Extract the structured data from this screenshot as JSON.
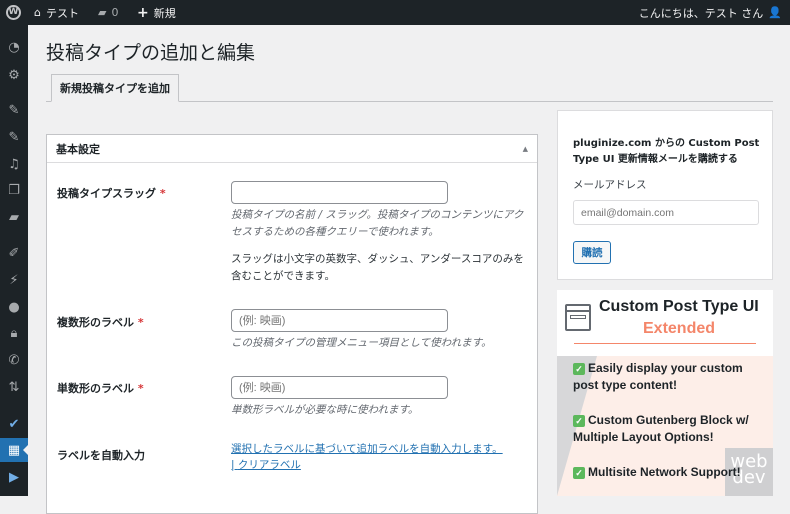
{
  "adminbar": {
    "site": "テスト",
    "comments": "0",
    "new": "新規",
    "greeting": "こんにちは、テスト さん"
  },
  "page": {
    "title": "投稿タイプの追加と編集",
    "tab": "新規投稿タイプを追加"
  },
  "basic": {
    "title": "基本設定",
    "slug": {
      "label": "投稿タイプスラッグ",
      "req": "*",
      "value": "",
      "desc": "投稿タイプの名前 / スラッグ。投稿タイプのコンテンツにアクセスするための各種クエリーで使われます。",
      "note": "スラッグは小文字の英数字、ダッシュ、アンダースコアのみを含むことができます。"
    },
    "plural": {
      "label": "複数形のラベル",
      "req": "*",
      "placeholder": "(例: 映画)",
      "desc": "この投稿タイプの管理メニュー項目として使われます。"
    },
    "singular": {
      "label": "単数形のラベル",
      "req": "*",
      "placeholder": "(例: 映画)",
      "desc": "単数形ラベルが必要な時に使われます。"
    },
    "auto": {
      "label": "ラベルを自動入力",
      "link1": "選択したラベルに基づいて追加ラベルを自動入力します。",
      "sep": "|",
      "link2": "クリアラベル"
    }
  },
  "newsletter": {
    "title": "pluginize.com からの Custom Post Type UI 更新情報メールを購読する",
    "email_label": "メールアドレス",
    "placeholder": "email@domain.com",
    "button": "購読"
  },
  "banner": {
    "title": "Custom Post Type UI",
    "subtitle": "Extended",
    "features": [
      "Easily display your custom post type content!",
      "Custom Gutenberg Block w/ Multiple Layout Options!",
      "Multisite Network Support!"
    ],
    "logo": "webdev"
  }
}
